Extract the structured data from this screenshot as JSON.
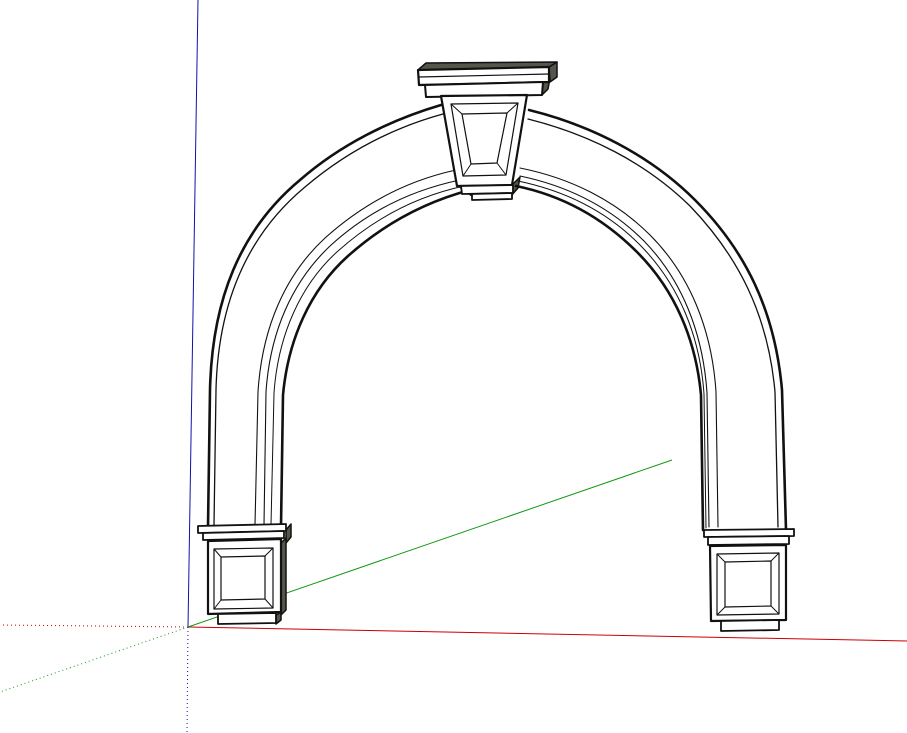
{
  "scene": {
    "background": "#ffffff",
    "axes": {
      "red_axis_color": "#cc0000",
      "green_axis_color": "#119911",
      "blue_axis_color": "#1111aa",
      "hidden_axis_style": "dotted"
    },
    "model": {
      "object": "arch",
      "fill_color": "#ffffff",
      "edge_color": "#111111",
      "shadow_color": "#55554a"
    }
  }
}
